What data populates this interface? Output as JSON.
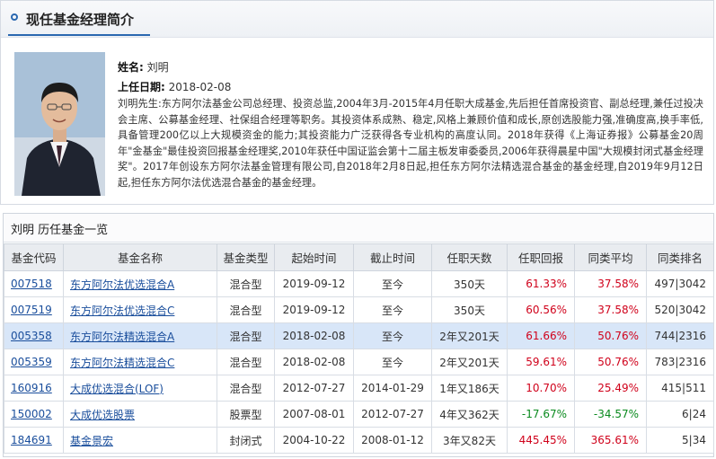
{
  "profile": {
    "header_title": "现任基金经理简介",
    "name_label": "姓名:",
    "name": "刘明",
    "start_label": "上任日期:",
    "start_date": "2018-02-08",
    "bio": "刘明先生:东方阿尔法基金公司总经理、投资总监,2004年3月-2015年4月任职大成基金,先后担任首席投资官、副总经理,兼任过投决会主席、公募基金经理、社保组合经理等职务。其投资体系成熟、稳定,风格上兼顾价值和成长,原创选股能力强,准确度高,换手率低,具备管理200亿以上大规模资金的能力;其投资能力广泛获得各专业机构的高度认同。2018年获得《上海证券报》公募基金20周年\"金基金\"最佳投资回报基金经理奖,2010年获任中国证监会第十二届主板发审委委员,2006年获得晨星中国\"大规模封闭式基金经理奖\"。2017年创设东方阿尔法基金管理有限公司,自2018年2月8日起,担任东方阿尔法精选混合基金的基金经理,自2019年9月12日起,担任东方阿尔法优选混合基金的基金经理。"
  },
  "history": {
    "title": "刘明 历任基金一览",
    "columns": [
      "基金代码",
      "基金名称",
      "基金类型",
      "起始时间",
      "截止时间",
      "任职天数",
      "任职回报",
      "同类平均",
      "同类排名"
    ],
    "rows": [
      {
        "code": "007518",
        "name": "东方阿尔法优选混合A",
        "type": "混合型",
        "start": "2019-09-12",
        "end": "至今",
        "days": "350天",
        "ret": "61.33%",
        "avg": "37.58%",
        "rank": "497|3042",
        "ret_color": "red",
        "avg_color": "red"
      },
      {
        "code": "007519",
        "name": "东方阿尔法优选混合C",
        "type": "混合型",
        "start": "2019-09-12",
        "end": "至今",
        "days": "350天",
        "ret": "60.56%",
        "avg": "37.58%",
        "rank": "520|3042",
        "ret_color": "red",
        "avg_color": "red"
      },
      {
        "code": "005358",
        "name": "东方阿尔法精选混合A",
        "type": "混合型",
        "start": "2018-02-08",
        "end": "至今",
        "days": "2年又201天",
        "ret": "61.66%",
        "avg": "50.76%",
        "rank": "744|2316",
        "ret_color": "red",
        "avg_color": "red",
        "highlight": true
      },
      {
        "code": "005359",
        "name": "东方阿尔法精选混合C",
        "type": "混合型",
        "start": "2018-02-08",
        "end": "至今",
        "days": "2年又201天",
        "ret": "59.61%",
        "avg": "50.76%",
        "rank": "783|2316",
        "ret_color": "red",
        "avg_color": "red"
      },
      {
        "code": "160916",
        "name": "大成优选混合(LOF)",
        "type": "混合型",
        "start": "2012-07-27",
        "end": "2014-01-29",
        "days": "1年又186天",
        "ret": "10.70%",
        "avg": "25.49%",
        "rank": "415|511",
        "ret_color": "red",
        "avg_color": "red"
      },
      {
        "code": "150002",
        "name": "大成优选股票",
        "type": "股票型",
        "start": "2007-08-01",
        "end": "2012-07-27",
        "days": "4年又362天",
        "ret": "-17.67%",
        "avg": "-34.57%",
        "rank": "6|24",
        "ret_color": "green",
        "avg_color": "green"
      },
      {
        "code": "184691",
        "name": "基金景宏",
        "type": "封闭式",
        "start": "2004-10-22",
        "end": "2008-01-12",
        "days": "3年又82天",
        "ret": "445.45%",
        "avg": "365.61%",
        "rank": "5|34",
        "ret_color": "red",
        "avg_color": "red"
      }
    ]
  }
}
